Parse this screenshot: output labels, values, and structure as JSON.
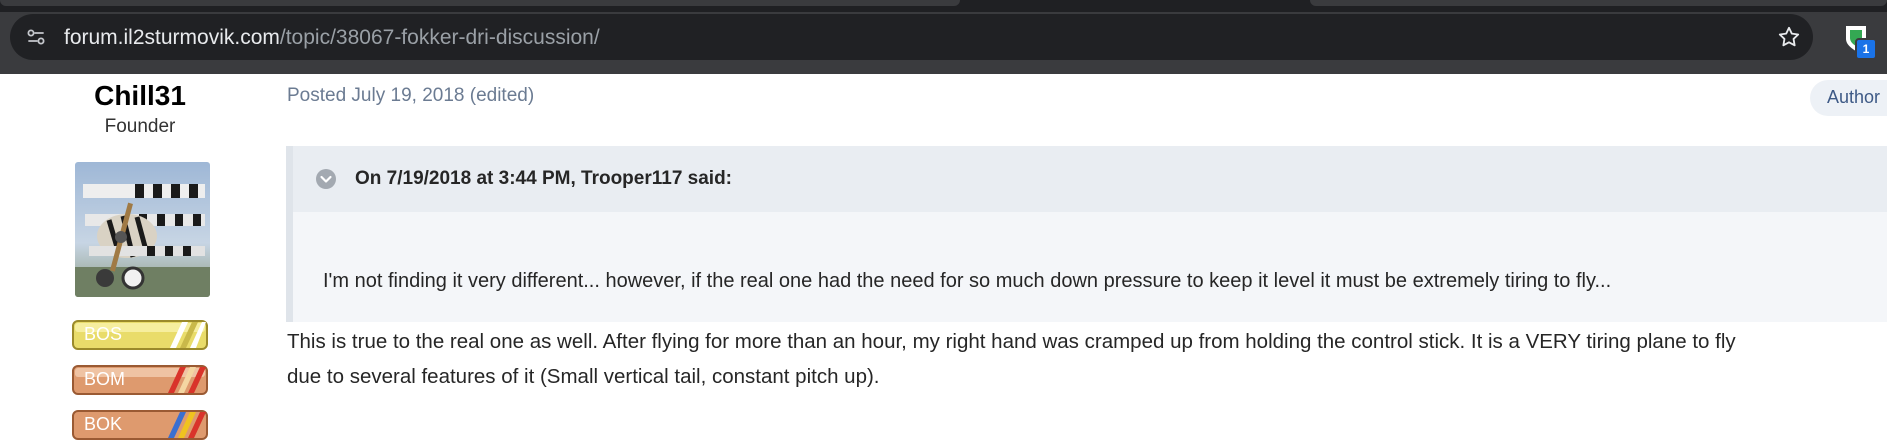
{
  "browser": {
    "url_host": "forum.il2sturmovik.com",
    "url_path": "/topic/38067-fokker-dri-discussion/",
    "extension_badge_count": "1",
    "icons": [
      "site-info-icon",
      "bookmark-star-icon",
      "extension-shield-icon"
    ]
  },
  "author": {
    "name": "Chill31",
    "rank": "Founder",
    "badges": [
      "BOS",
      "BOM",
      "BOK"
    ]
  },
  "post": {
    "posted": "Posted July 19, 2018 (edited)",
    "author_tag": "Author",
    "quote": {
      "citation": "On 7/19/2018 at 3:44 PM, Trooper117 said:",
      "text": "I'm not finding it very different... however, if the real one had the need for so much down pressure to keep it level it must be extremely tiring to fly..."
    },
    "body": [
      "This is true to the real one as well.  After flying for more than an hour, my right hand was cramped up from holding the control stick.  It is a VERY tiring plane to fly",
      "due to several features of it (Small vertical tail, constant pitch up)."
    ]
  },
  "colors": {
    "chrome_bg": "#3a3b3e",
    "omnibox_bg": "#202124",
    "meta_text": "#6b7b92",
    "quote_bg": "#f4f6f9",
    "quote_header_bg": "#e9edf2",
    "author_tag_text": "#3e5a86"
  }
}
